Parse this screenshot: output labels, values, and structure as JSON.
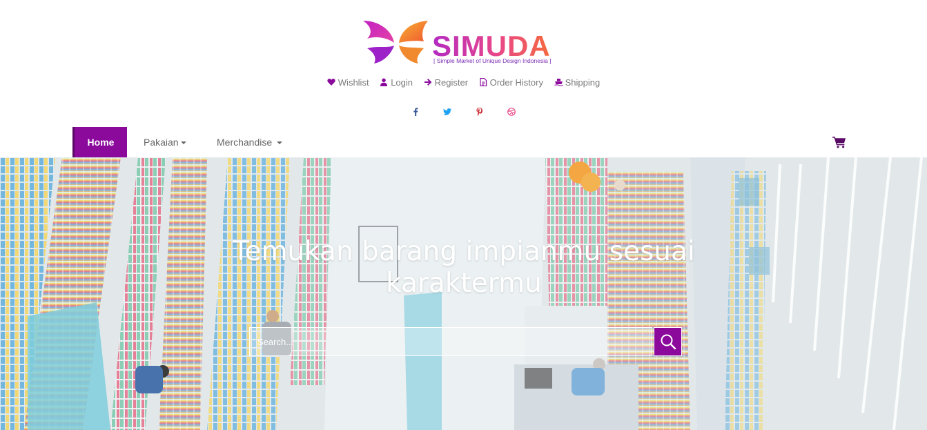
{
  "brand": {
    "name": "SIMUDA",
    "tagline": "[ Simple Market of Unique Design Indonesia ]"
  },
  "top_menu": [
    {
      "label": "Wishlist",
      "icon": "heart-icon"
    },
    {
      "label": "Login",
      "icon": "user-icon"
    },
    {
      "label": "Register",
      "icon": "arrow-right-icon"
    },
    {
      "label": "Order History",
      "icon": "file-icon"
    },
    {
      "label": "Shipping",
      "icon": "ship-icon"
    }
  ],
  "social": [
    {
      "icon": "facebook-icon",
      "glyph": "f",
      "color": "#3b5998"
    },
    {
      "icon": "twitter-icon",
      "glyph": "t",
      "color": "#1da1f2"
    },
    {
      "icon": "pinterest-icon",
      "glyph": "p",
      "color": "#cb2027"
    },
    {
      "icon": "dribbble-icon",
      "glyph": "d",
      "color": "#ea4c89"
    }
  ],
  "nav": {
    "home": "Home",
    "pakaian": "Pakaian",
    "merchandise": "Merchandise",
    "cart_icon": "shopping-cart-icon"
  },
  "hero": {
    "title": "Temukan barang impianmu sesuai karaktermu",
    "search_placeholder": "Search...",
    "search_icon": "search-icon"
  },
  "colors": {
    "accent": "#8b0a9c",
    "logo_gradient": [
      "#b22ac2",
      "#e9478a",
      "#f46a3c"
    ]
  }
}
